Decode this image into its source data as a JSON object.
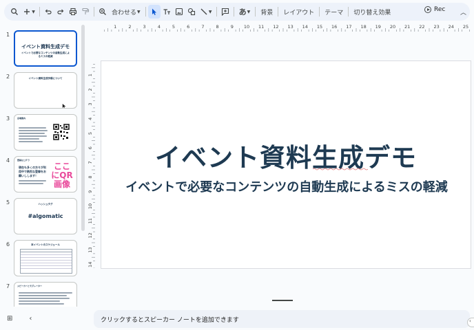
{
  "toolbar": {
    "zoom_label": "合わせる",
    "font_char": "あ",
    "background_label": "背景",
    "layout_label": "レイアウト",
    "theme_label": "テーマ",
    "transition_label": "切り替え効果",
    "record_label": "Rec"
  },
  "ruler": {
    "h_ticks": [
      "1",
      "2",
      "3",
      "4",
      "5",
      "6",
      "7",
      "8",
      "9",
      "10",
      "11",
      "12",
      "13",
      "14",
      "15",
      "16",
      "17",
      "18",
      "19",
      "20",
      "21",
      "22",
      "23",
      "24",
      "25"
    ],
    "v_ticks": [
      "1",
      "2",
      "3",
      "4",
      "5",
      "6",
      "7",
      "8",
      "9",
      "10",
      "11",
      "12",
      "13",
      "14"
    ]
  },
  "filmstrip": {
    "slides": [
      {
        "num": "1",
        "title": "イベント資料生成デモ",
        "subtitle": "イベントで必要なコンテンツの自動生成によるミスの軽減"
      },
      {
        "num": "2",
        "title": "イベント資料生成手順について"
      },
      {
        "num": "3",
        "title": "会場案内"
      },
      {
        "num": "4",
        "title": "登録はコチラ",
        "body": "現在も多くの方々が利用中で熱烈な登録をお願いしします！",
        "pink": "ここにQR画像"
      },
      {
        "num": "5",
        "title": "ハッシュタグ",
        "hashtag": "#algomatic"
      },
      {
        "num": "6",
        "title": "本イベントのスケジュール"
      },
      {
        "num": "7",
        "title": "スピーカーとモデレーター"
      }
    ]
  },
  "slide": {
    "title": "イベント資料生成デモ",
    "subtitle": "イベントで必要なコンテンツの自動生成によるミスの軽減"
  },
  "notes": {
    "placeholder": "クリックするとスピーカー ノートを追加できます"
  }
}
